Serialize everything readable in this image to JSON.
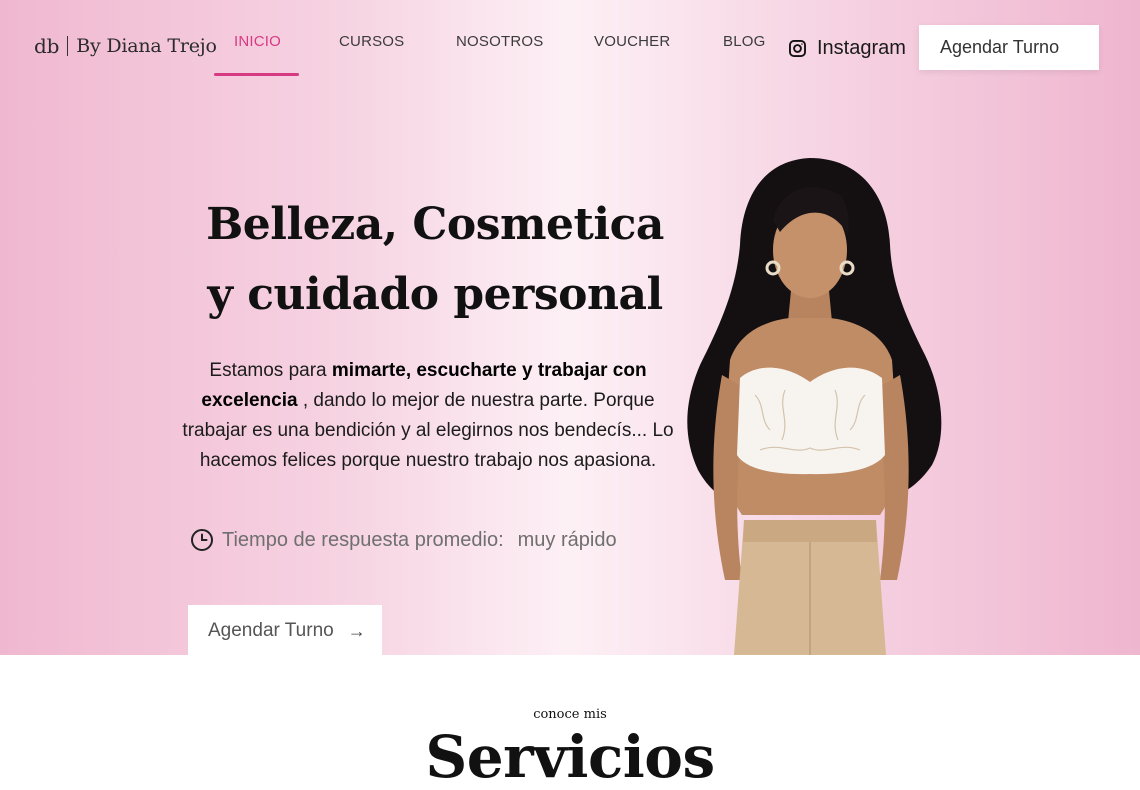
{
  "brand": {
    "mark": "db",
    "name": "By Diana Trejo"
  },
  "nav": {
    "items": [
      {
        "label": "INICIO",
        "active": true
      },
      {
        "label": "CURSOS",
        "active": false
      },
      {
        "label": "NOSOTROS",
        "active": false
      },
      {
        "label": "VOUCHER",
        "active": false
      },
      {
        "label": "BLOG",
        "active": false
      }
    ],
    "instagram_label": "Instagram",
    "cta_label": "Agendar Turno"
  },
  "hero": {
    "headline_line1": "Belleza, Cosmetica",
    "headline_line2": "y cuidado personal",
    "desc_pre": "Estamos para ",
    "desc_bold": "mimarte, escucharte y trabajar con excelencia",
    "desc_post": " , dando lo mejor de nuestra parte. Porque trabajar es una bendición y al elegirnos nos bendecís... Lo hacemos felices porque nuestro trabajo nos apasiona.",
    "response_label": "Tiempo de respuesta promedio:",
    "response_value": "muy rápido",
    "cta_label": "Agendar Turno",
    "cta_arrow": "→"
  },
  "services": {
    "kicker": "conoce mis",
    "title": "Servicios"
  },
  "colors": {
    "accent": "#d63a83",
    "hero_pink": "#f0b8d0",
    "hero_light": "#fdf0f5"
  },
  "icons": {
    "instagram": "instagram-icon",
    "clock": "clock-icon",
    "arrow": "arrow-right-icon"
  }
}
